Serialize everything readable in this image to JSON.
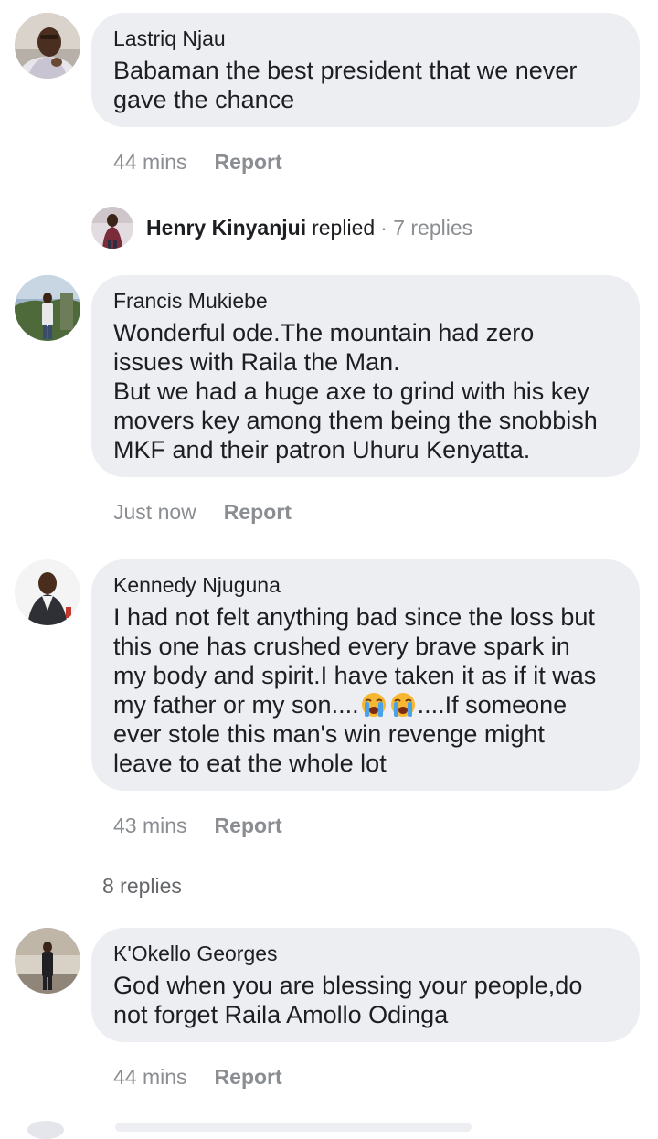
{
  "comments": [
    {
      "author": "Lastriq Njau",
      "lines": [
        "Babaman the best president that we never",
        "gave the chance"
      ],
      "time": "44 mins",
      "report_label": "Report"
    },
    {
      "author": "Francis Mukiebe",
      "lines": [
        "Wonderful ode.The mountain had zero",
        "issues with Raila the Man.",
        "But we had a huge axe to grind with his key",
        "movers key among them being the snobbish",
        "MKF and their patron Uhuru Kenyatta."
      ],
      "time": "Just now",
      "report_label": "Report"
    },
    {
      "author": "Kennedy Njuguna",
      "lines": [
        "I had not felt anything bad since the loss but",
        "this one has crushed every brave spark in",
        "my body and spirit.I have taken it as if it was",
        "my father or my son....",
        "....If someone",
        "ever stole this man's win revenge might",
        "leave to eat the whole lot"
      ],
      "emoji": "loudly-crying-face-emoji",
      "time": "43 mins",
      "report_label": "Report",
      "more_replies": "8 replies"
    },
    {
      "author": "K'Okello Georges",
      "lines": [
        "God when you are blessing your people,do",
        "not forget Raila Amollo Odinga"
      ],
      "time": "44 mins",
      "report_label": "Report"
    }
  ],
  "reply_preview": {
    "name": "Henry Kinyanjui",
    "verb": "replied",
    "count": "· 7 replies"
  },
  "colors": {
    "bubble": "#eceef1",
    "meta_text": "#8a8d91",
    "body_text": "#1c1e21"
  }
}
